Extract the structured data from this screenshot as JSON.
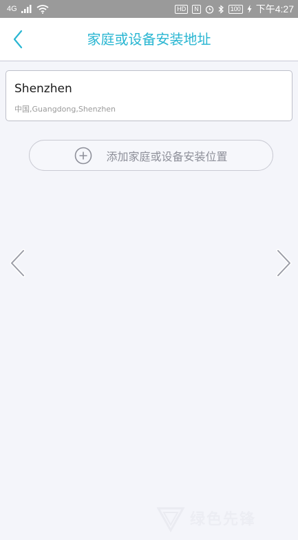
{
  "status_bar": {
    "network": "4G",
    "hd_badge": "HD",
    "nfc": "N",
    "battery": "100",
    "time": "下午4:27"
  },
  "header": {
    "title": "家庭或设备安装地址"
  },
  "addresses": [
    {
      "name": "Shenzhen",
      "detail": "中国,Guangdong,Shenzhen"
    }
  ],
  "add_button": {
    "label": "添加家庭或设备安装位置"
  },
  "watermark": {
    "text": "绿色先锋"
  },
  "colors": {
    "accent": "#29b6d2",
    "background": "#f4f5fa",
    "status_bar": "#9a9a9a",
    "muted_text": "#8d8f99"
  },
  "icons": {
    "back": "chevron-left-icon",
    "add": "plus-circle-icon",
    "prev": "chevron-left-icon",
    "next": "chevron-right-icon"
  }
}
